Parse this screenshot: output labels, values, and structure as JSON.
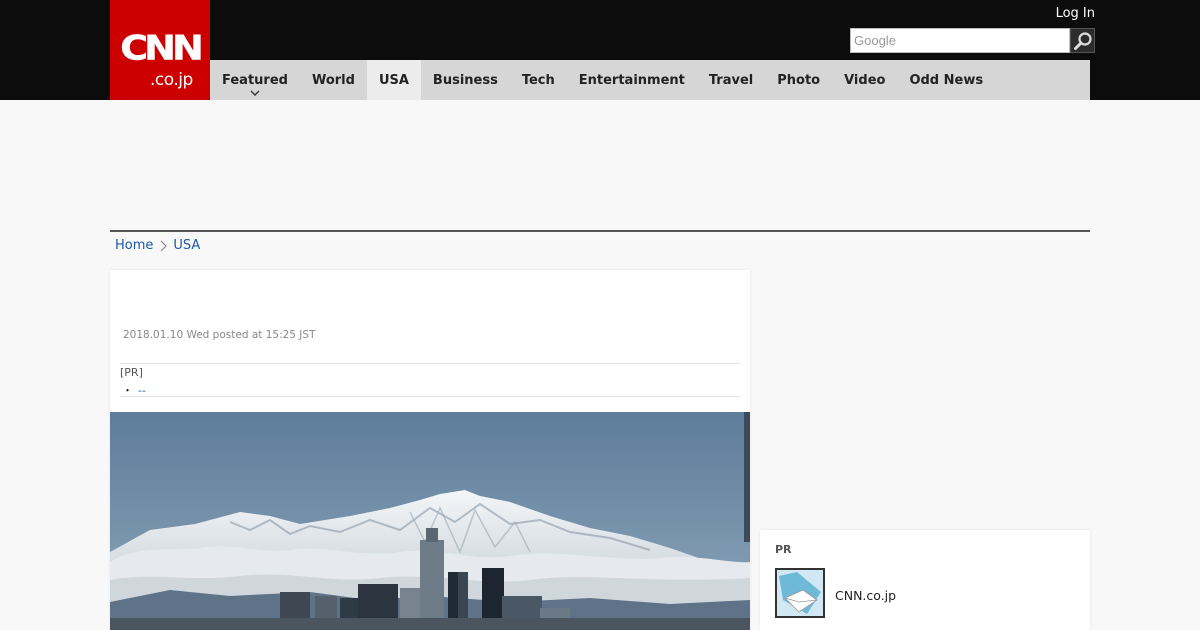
{
  "logo": {
    "main": "CNN",
    "sub": ".co.jp"
  },
  "header": {
    "login_label": "Log In",
    "search_placeholder": "Google"
  },
  "nav": {
    "featured": "Featured",
    "world": "World",
    "usa": "USA",
    "business": "Business",
    "tech": "Tech",
    "entertainment": "Entertainment",
    "travel": "Travel",
    "photo": "Photo",
    "video": "Video",
    "odd_news": "Odd News"
  },
  "breadcrumb": {
    "home": "Home",
    "current": "USA"
  },
  "article": {
    "date": "2018.01.10 Wed posted at 15:25 JST",
    "pr_label": "[PR]",
    "pr_bullet": "・",
    "pr_link": "--"
  },
  "sidebar": {
    "pr_title": "PR",
    "pr_item_label": "CNN.co.jp"
  },
  "colors": {
    "brand_red": "#cc0000",
    "topbar": "#0c0c0c",
    "nav_bg": "#d6d6d6",
    "link": "#1a5aa8"
  },
  "icons": {
    "search": "magnifier-icon",
    "caret": "chevron-down-icon",
    "breadcrumb_sep": "chevron-right-icon"
  }
}
